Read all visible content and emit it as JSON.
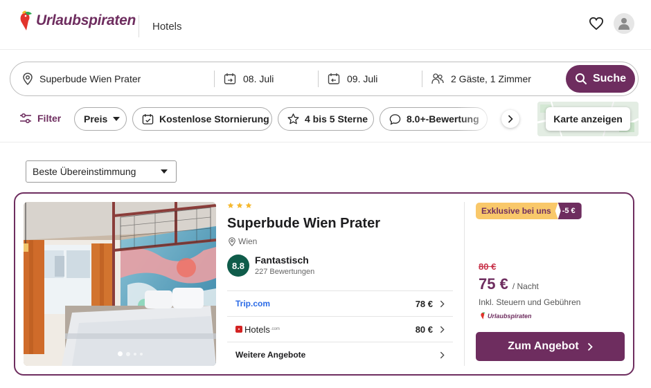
{
  "header": {
    "brand": "Urlaubspiraten",
    "nav_item": "Hotels",
    "icons": [
      "heart-icon",
      "user-icon"
    ]
  },
  "search": {
    "destination": "Superbude Wien Prater",
    "checkin": "08. Juli",
    "checkout": "09. Juli",
    "guests": "2 Gäste, 1 Zimmer",
    "button_label": "Suche"
  },
  "filters": {
    "label": "Filter",
    "chips": [
      "Preis",
      "Kostenlose Stornierung",
      "4 bis 5 Sterne",
      "8.0+-Bewertung"
    ],
    "map_button": "Karte anzeigen"
  },
  "sort": {
    "selected": "Beste Übereinstimmung"
  },
  "hotel": {
    "stars": 3,
    "name": "Superbude Wien Prater",
    "city": "Wien",
    "score": "8.8",
    "rating_word": "Fantastisch",
    "review_count": "227 Bewertungen",
    "offers": [
      {
        "provider": "Trip.com",
        "price": "78 €"
      },
      {
        "provider": "Hotels",
        "provider_suffix": ".com",
        "price": "80 €"
      },
      {
        "provider": "Weitere Angebote",
        "price": ""
      }
    ],
    "badge": {
      "label": "Exklusive bei uns",
      "discount": "-5 €"
    },
    "old_price": "80 €",
    "price": "75 €",
    "per_night": "/ Nacht",
    "tax_note": "Inkl. Steuern und Gebühren",
    "seller": "Urlaubspiraten",
    "cta": "Zum Angebot",
    "gallery": {
      "active_index": 0,
      "count": 4
    }
  },
  "colors": {
    "brand": "#6e2d5f",
    "score": "#0f5c4a",
    "badge": "#f9c86a",
    "old_price": "#c8334a"
  }
}
